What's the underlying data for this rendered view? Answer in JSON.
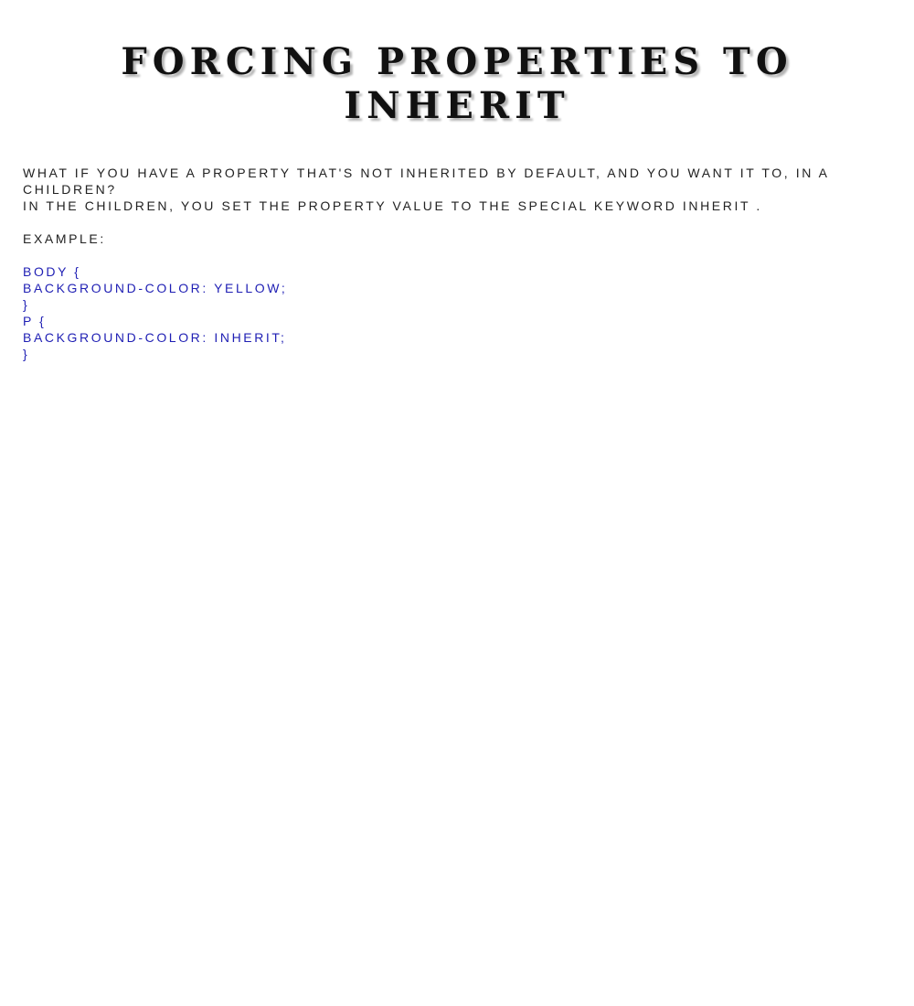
{
  "page": {
    "title": "Forcing properties to inherit"
  },
  "intro": {
    "line1": "What if you have a property that's not inherited by default, and you want it to, in a children?",
    "line2": "In the children, you set the property value to the special keyword inherit ."
  },
  "example": {
    "label": "Example:",
    "code_lines": [
      "body {",
      "background-color: yellow;",
      "}",
      "p {",
      "background-color: inherit;",
      "}"
    ]
  },
  "colors": {
    "code": "#1f1fb4",
    "text": "#222222",
    "title_shadow": "#b3b3b3"
  }
}
